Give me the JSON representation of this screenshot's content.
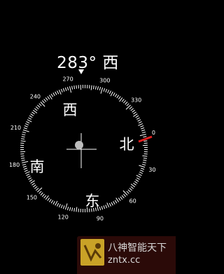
{
  "compass": {
    "heading_value": "283°",
    "heading_direction": "西",
    "directions": {
      "north": "北",
      "south": "南",
      "east": "东",
      "west": "西"
    },
    "degree_labels": [
      "0",
      "30",
      "60",
      "90",
      "120",
      "150",
      "180",
      "210",
      "240",
      "270",
      "300",
      "330"
    ],
    "colors": {
      "background": "#000000",
      "ticks": "#ffffff",
      "north_needle": "#e02020"
    }
  },
  "watermark": {
    "line1": "八神智能天下",
    "line2": "zntx.cc"
  }
}
